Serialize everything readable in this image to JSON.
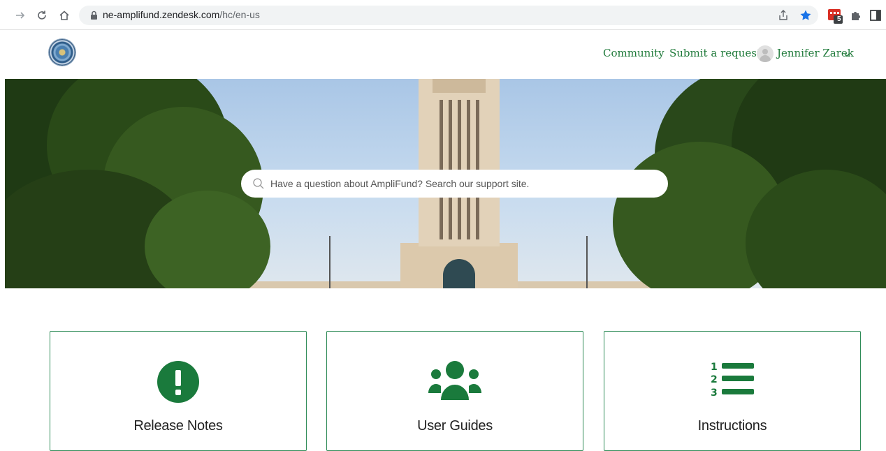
{
  "browser": {
    "url_domain": "ne-amplifund.zendesk.com",
    "url_path": "/hc/en-us",
    "extension_badge": "5",
    "icons": [
      "forward-icon",
      "reload-icon",
      "home-icon",
      "lock-icon",
      "share-icon",
      "bookmark-star-icon",
      "extension-icon",
      "puzzle-icon",
      "side-panel-icon"
    ]
  },
  "header": {
    "logo_icon": "state-seal-logo",
    "community": "Community",
    "submit_request": "Submit a request",
    "user_name": "Jennifer Zarek"
  },
  "hero": {
    "search_placeholder": "Have a question about AmpliFund? Search our support site."
  },
  "cards": [
    {
      "title": "Release Notes",
      "icon": "exclamation-circle-icon"
    },
    {
      "title": "User Guides",
      "icon": "users-group-icon"
    },
    {
      "title": "Instructions",
      "icon": "numbered-list-icon"
    }
  ],
  "colors": {
    "accent": "#1f7a3a",
    "card_border": "#2e8b57",
    "icon_green": "#1a7a3c"
  }
}
